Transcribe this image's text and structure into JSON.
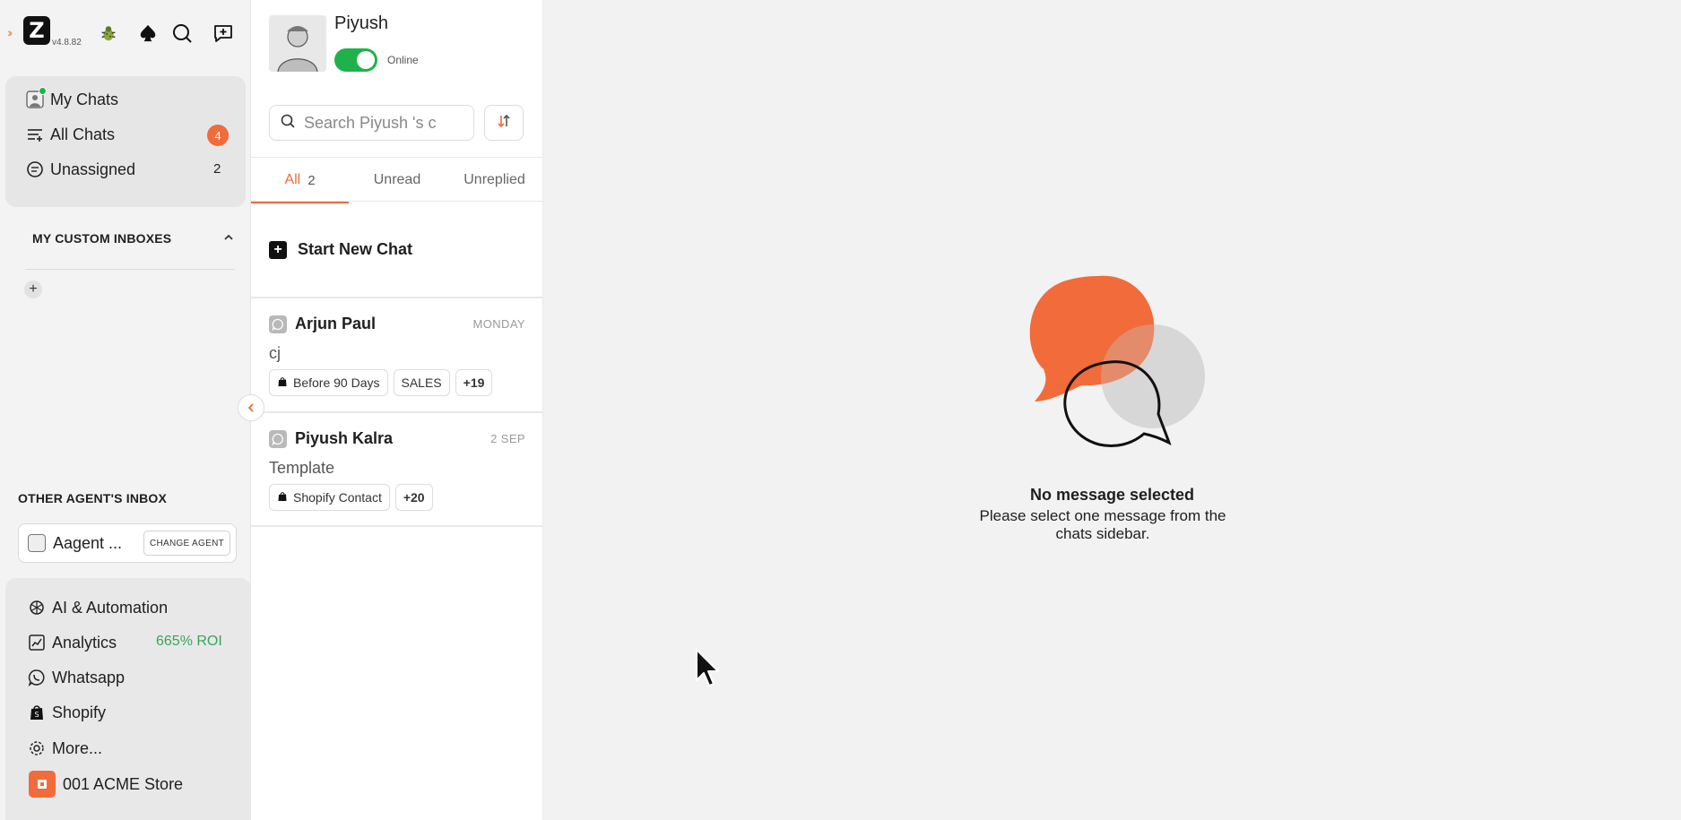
{
  "app": {
    "version": "v4.8.82"
  },
  "nav": {
    "my_chats": "My Chats",
    "all_chats": "All Chats",
    "all_chats_count": "4",
    "unassigned": "Unassigned",
    "unassigned_count": "2"
  },
  "custom_inboxes": {
    "title": "MY CUSTOM INBOXES"
  },
  "other_agent": {
    "title": "OTHER AGENT'S INBOX",
    "agent_name": "Aagent ...",
    "change_label": "CHANGE AGENT"
  },
  "bottom_nav": {
    "items": [
      {
        "label": "AI & Automation",
        "icon": "ai-icon"
      },
      {
        "label": "Analytics",
        "icon": "chart-icon"
      },
      {
        "label": "Whatsapp",
        "icon": "whatsapp-icon"
      },
      {
        "label": "Shopify",
        "icon": "shopify-icon"
      },
      {
        "label": "More...",
        "icon": "gear-icon"
      }
    ],
    "roi": "665% ROI",
    "store": "001 ACME Store"
  },
  "profile": {
    "name": "Piyush",
    "status": "Online"
  },
  "search": {
    "placeholder": "Search Piyush 's c"
  },
  "tabs": {
    "all": "All",
    "all_count": "2",
    "unread": "Unread",
    "unreplied": "Unreplied"
  },
  "new_chat": "Start New Chat",
  "chats": [
    {
      "name": "Arjun Paul",
      "date": "MONDAY",
      "message": "cj",
      "tags": [
        "Before 90 Days",
        "SALES"
      ],
      "more": "+19"
    },
    {
      "name": "Piyush Kalra",
      "date": "2 SEP",
      "message": "Template",
      "tags": [
        "Shopify Contact"
      ],
      "more": "+20"
    }
  ],
  "empty_state": {
    "title": "No message selected",
    "subtitle": "Please select one message from the chats sidebar."
  },
  "colors": {
    "accent": "#f26b3a",
    "online": "#1fb24a",
    "roi": "#3aa35a"
  }
}
